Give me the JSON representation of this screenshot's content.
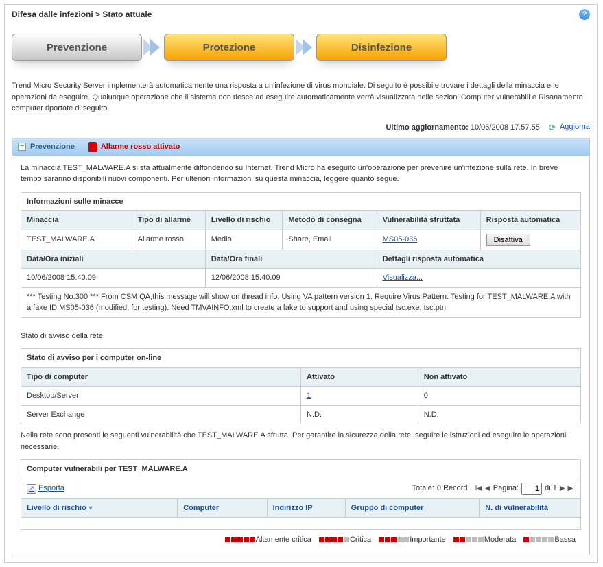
{
  "breadcrumb": "Difesa dalle infezioni > Stato attuale",
  "steps": {
    "s1": "Prevenzione",
    "s2": "Protezione",
    "s3": "Disinfezione"
  },
  "intro": "Trend Micro Security Server implementerà automaticamente una risposta a un'infezione  di virus mondiale. Di seguito è possibile trovare i dettagli della minaccia e le operazioni da eseguire. Qualunque operazione che il sistema non riesce ad eseguire automaticamente verrà visualizzata nelle sezioni Computer vulnerabili e Risanamento computer riportate di seguito.",
  "update": {
    "label": "Ultimo aggiornamento:",
    "value": "10/06/2008 17.57.55",
    "refresh": "Aggiorna"
  },
  "prev_panel": {
    "title": "Prevenzione",
    "alarm": "Allarme rosso attivato",
    "desc": "La minaccia TEST_MALWARE.A si sta attualmente diffondendo su Internet. Trend Micro ha eseguito un'operazione per prevenire un'infezione sulla rete. In breve tempo saranno disponibili nuovi componenti. Per ulteriori informazioni su questa minaccia, leggere quanto segue."
  },
  "threat_table": {
    "title": "Informazioni sulle minacce",
    "h1": "Minaccia",
    "h2": "Tipo di allarme",
    "h3": "Livello di rischio",
    "h4": "Metodo di consegna",
    "h5": "Vulnerabilità sfruttata",
    "h6": "Risposta automatica",
    "v1": "TEST_MALWARE.A",
    "v2": "Allarme rosso",
    "v3": "Medio",
    "v4": "Share, Email",
    "v5": "MS05-036",
    "v6": "Disattiva",
    "h7": "Data/Ora iniziali",
    "h8": "Data/Ora finali",
    "h9": "Dettagli risposta automatica",
    "v7": "10/06/2008 15.40.09",
    "v8": "12/06/2008 15.40.09",
    "v9": "Visualizza...",
    "note": "*** Testing No.300 *** From CSM QA,this message will show on thread info. Using VA pattern version 1. Require Virus Pattern. Testing for TEST_MALWARE.A with a fake ID MS05-036 (modified, for testing). Need TMVAINFO.xml to create a fake to support and using special tsc.exe, tsc.ptn"
  },
  "net_status": {
    "label": "Stato di avviso della rete.",
    "title": "Stato di avviso per i computer on-line",
    "h1": "Tipo di computer",
    "h2": "Attivato",
    "h3": "Non attivato",
    "r1c1": "Desktop/Server",
    "r1c2": "1",
    "r1c3": "0",
    "r2c1": "Server Exchange",
    "r2c2": "N.D.",
    "r2c3": "N.D.",
    "note": "Nella rete sono presenti le seguenti vulnerabilità che TEST_MALWARE.A sfrutta. Per garantire la sicurezza della rete, seguire le istruzioni ed eseguire le operazioni necessarie."
  },
  "vuln": {
    "title": "Computer vulnerabili per TEST_MALWARE.A",
    "export": "Esporta",
    "totale_label": "Totale:",
    "totale_val": "0 Record",
    "pagina_label": "Pagina:",
    "page_val": "1",
    "page_of": "di 1",
    "c1": "Livello di rischio",
    "c2": "Computer",
    "c3": "Indirizzo IP",
    "c4": "Gruppo di computer",
    "c5": "N. di vulnerabilità"
  },
  "legend": {
    "l1": "Altamente critica",
    "l2": "Critica",
    "l3": "Importante",
    "l4": "Moderata",
    "l5": "Bassa"
  }
}
